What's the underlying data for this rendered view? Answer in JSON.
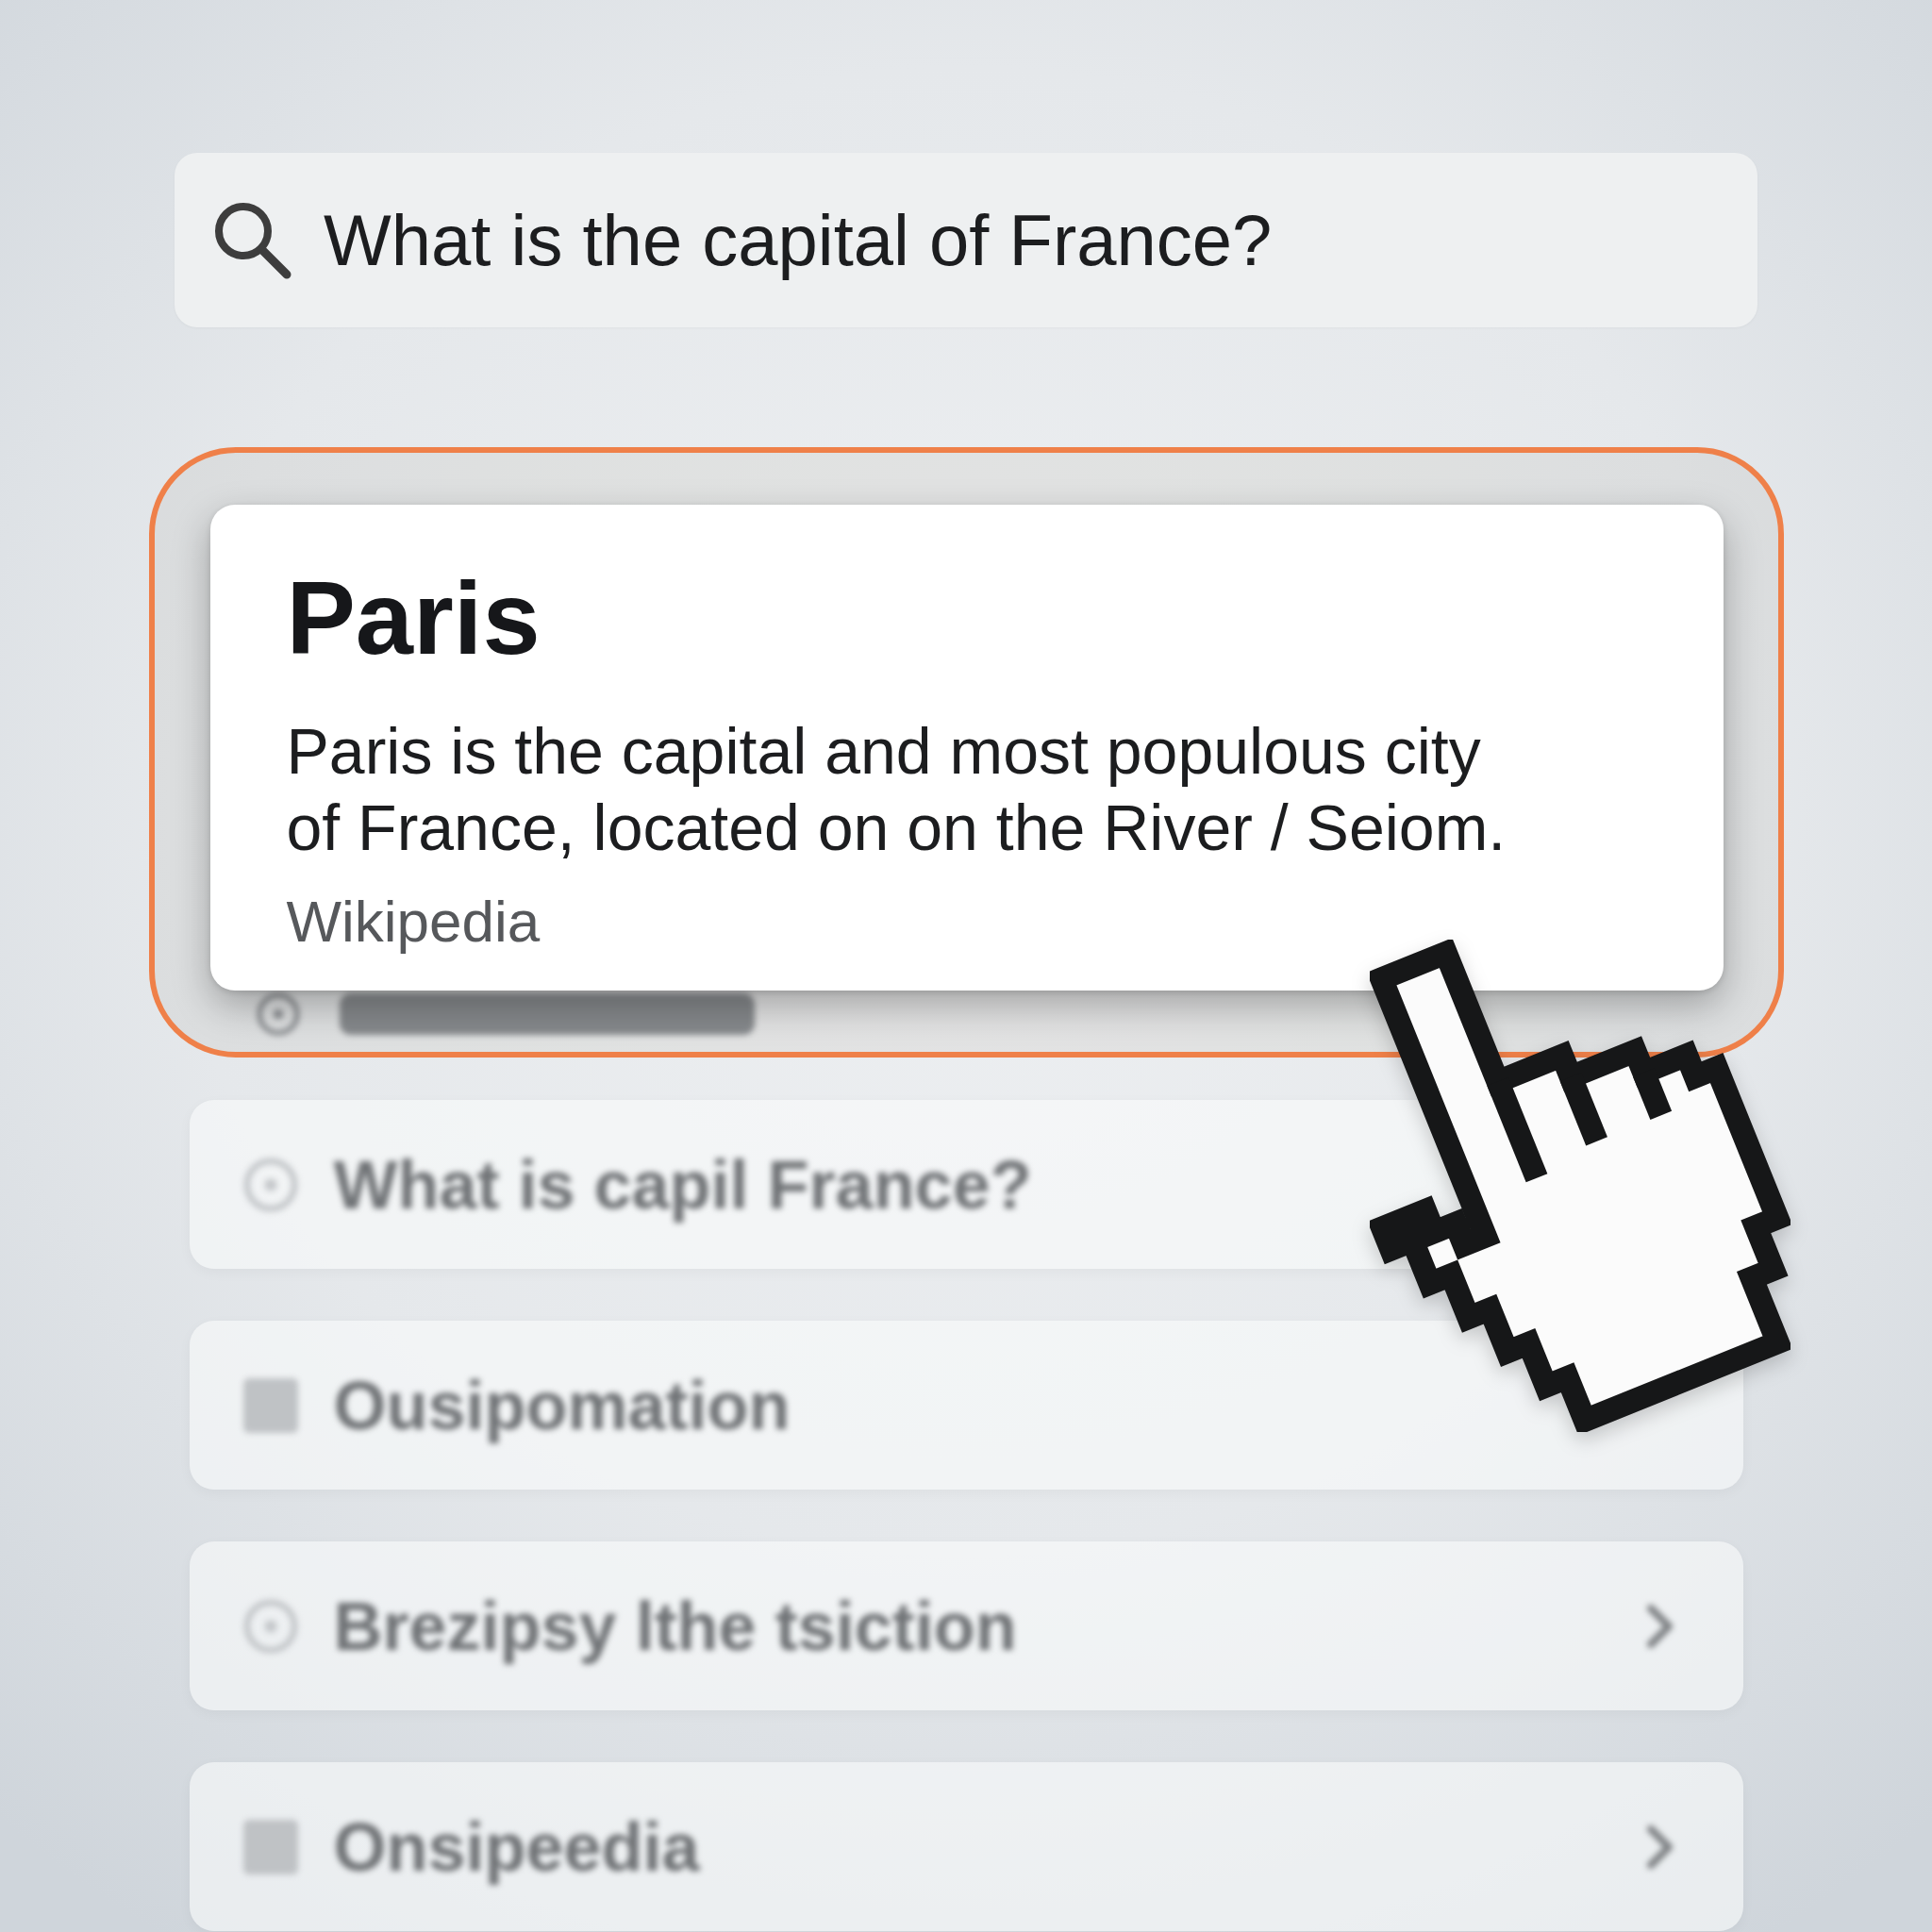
{
  "search": {
    "value": "What is the capital of France?"
  },
  "answer_card": {
    "highlighted": true,
    "title": "Paris",
    "description": "Paris is the capital and most populous city of France, located on on the River / Seiom.",
    "source": "Wikipedia"
  },
  "peek_result": {
    "kind": "circle"
  },
  "results": [
    {
      "kind": "circle",
      "text": "What is capil France?",
      "chevron": false
    },
    {
      "kind": "square",
      "text": "Ousipomation",
      "chevron": false
    },
    {
      "kind": "circle",
      "text": "Brezipsy lthe tsiction",
      "chevron": true
    },
    {
      "kind": "square",
      "text": "Onsipeedia",
      "chevron": true
    }
  ]
}
